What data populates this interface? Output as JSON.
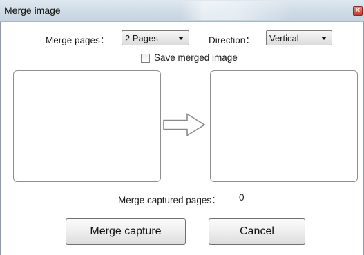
{
  "window": {
    "title": "Merge image",
    "close_icon": "close-icon"
  },
  "merge_pages": {
    "label": "Merge pages：",
    "value": "2 Pages"
  },
  "direction": {
    "label": "Direction：",
    "value": "Vertical"
  },
  "save_merged": {
    "label": "Save merged image",
    "checked": false
  },
  "arrow_icon": "right-arrow-icon",
  "status": {
    "label": "Merge captured pages：",
    "count": "0"
  },
  "buttons": {
    "merge": "Merge capture",
    "cancel": "Cancel"
  },
  "colors": {
    "titlebar": "#cfdbe5",
    "close": "#c7382a",
    "panel_border": "#8f8f8f"
  }
}
